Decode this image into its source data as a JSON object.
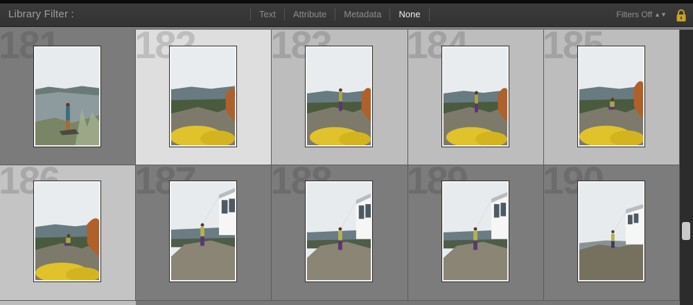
{
  "filter_bar": {
    "title": "Library Filter :",
    "tabs": [
      {
        "label": "Text"
      },
      {
        "label": "Attribute"
      },
      {
        "label": "Metadata"
      },
      {
        "label": "None"
      }
    ],
    "active_tab": "None",
    "filters_off_label": "Filters Off",
    "lock_icon": "lock-icon"
  },
  "grid": {
    "cells": [
      {
        "index": "181",
        "scene": "lake"
      },
      {
        "index": "182",
        "scene": "flowers"
      },
      {
        "index": "183",
        "scene": "flowers"
      },
      {
        "index": "184",
        "scene": "flowers"
      },
      {
        "index": "185",
        "scene": "flowers-sitting"
      },
      {
        "index": "186",
        "scene": "flowers-sitting"
      },
      {
        "index": "187",
        "scene": "lookout"
      },
      {
        "index": "188",
        "scene": "lookout"
      },
      {
        "index": "189",
        "scene": "lookout"
      },
      {
        "index": "190",
        "scene": "lookout-wide"
      }
    ]
  },
  "colors": {
    "toolbar_bg": "#363636",
    "cell_dark": "#7b7b7b",
    "cell_light": "#c4c4c4",
    "cell_selected": "#dedede",
    "active_tab_text": "#f0f0f0"
  }
}
